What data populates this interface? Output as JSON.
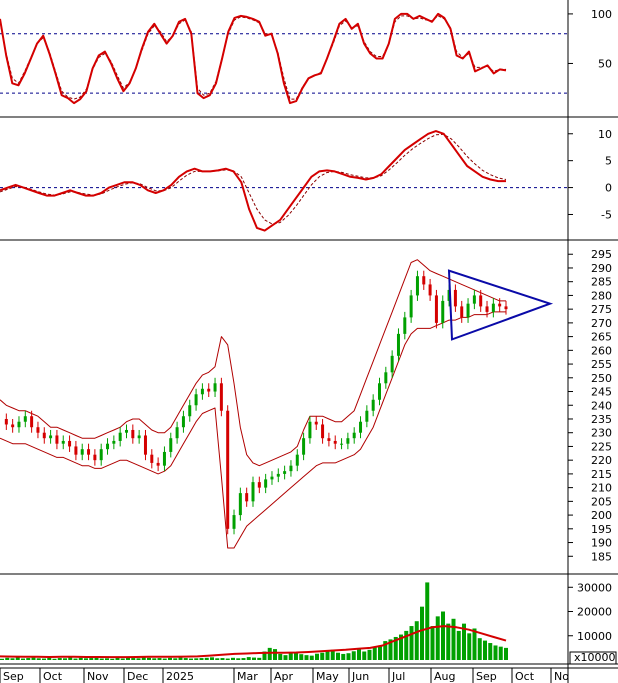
{
  "colors": {
    "price_line": "#d40000",
    "signal_line": "#8b0000",
    "bollinger": "#b00000",
    "triangle": "#0a0aa8",
    "reference": "#00008b",
    "volume_bar": "#00a000",
    "up_candle": "#00a000",
    "down_candle": "#d40000"
  },
  "chart_data": [
    {
      "type": "line",
      "panel": "stochastic",
      "y_ticks": [
        50,
        100
      ],
      "ylim": [
        0,
        110
      ],
      "reference_lines": [
        20,
        80
      ],
      "series": [
        {
          "role": "main",
          "values": [
            95,
            58,
            30,
            28,
            40,
            55,
            70,
            78,
            60,
            40,
            18,
            15,
            10,
            14,
            22,
            45,
            58,
            62,
            50,
            35,
            22,
            30,
            45,
            65,
            82,
            90,
            80,
            70,
            78,
            92,
            95,
            80,
            20,
            15,
            18,
            30,
            55,
            82,
            96,
            98,
            97,
            95,
            92,
            78,
            80,
            60,
            30,
            10,
            12,
            25,
            35,
            38,
            40,
            55,
            72,
            90,
            95,
            85,
            90,
            70,
            60,
            55,
            55,
            70,
            95,
            100,
            100,
            95,
            98,
            95,
            92,
            100,
            96,
            85,
            58,
            55,
            62,
            42,
            45,
            48,
            40,
            44,
            43
          ]
        },
        {
          "role": "signal",
          "values": [
            92,
            60,
            35,
            30,
            42,
            56,
            70,
            76,
            62,
            42,
            22,
            16,
            14,
            16,
            24,
            44,
            56,
            60,
            52,
            38,
            25,
            31,
            45,
            63,
            80,
            88,
            82,
            72,
            78,
            90,
            94,
            82,
            25,
            18,
            20,
            32,
            56,
            80,
            94,
            97,
            96,
            94,
            91,
            80,
            79,
            62,
            35,
            14,
            14,
            26,
            35,
            38,
            41,
            55,
            70,
            88,
            93,
            86,
            88,
            72,
            62,
            57,
            57,
            70,
            92,
            98,
            98,
            95,
            96,
            94,
            93,
            98,
            95,
            86,
            62,
            56,
            60,
            46,
            46,
            47,
            42,
            44,
            44
          ]
        }
      ]
    },
    {
      "type": "line",
      "panel": "macd",
      "y_ticks": [
        -5,
        0,
        5,
        10
      ],
      "ylim": [
        -9,
        12
      ],
      "reference_lines": [
        0
      ],
      "series": [
        {
          "role": "main",
          "values": [
            -0.5,
            0,
            0.5,
            0,
            -0.5,
            -1,
            -1.5,
            -1.5,
            -1,
            -0.5,
            -1,
            -1.5,
            -1.5,
            -1,
            0,
            0.5,
            1,
            1,
            0.5,
            -0.5,
            -1,
            -0.5,
            0.5,
            2,
            3,
            3.5,
            3,
            3,
            3.2,
            3.5,
            3,
            1,
            -4,
            -7.5,
            -8,
            -7,
            -6,
            -4,
            -2,
            0,
            2,
            3,
            3.2,
            3,
            2.5,
            2,
            1.8,
            1.5,
            1.8,
            2.5,
            4,
            5.5,
            7,
            8,
            9,
            10,
            10.5,
            10,
            8,
            6,
            4,
            3,
            2,
            1.5,
            1.2,
            1.2
          ]
        },
        {
          "role": "signal",
          "values": [
            -0.8,
            -0.3,
            0.2,
            0.1,
            -0.3,
            -0.8,
            -1.2,
            -1.4,
            -1.2,
            -0.8,
            -0.9,
            -1.2,
            -1.4,
            -1.2,
            -0.5,
            0.1,
            0.6,
            0.9,
            0.7,
            0,
            -0.6,
            -0.6,
            0,
            1.2,
            2.3,
            3,
            3,
            3,
            3.1,
            3.3,
            3.1,
            2,
            -1,
            -4,
            -6,
            -6.8,
            -6.5,
            -5.2,
            -3.5,
            -1.5,
            0.5,
            2,
            2.8,
            3,
            2.8,
            2.4,
            2.1,
            1.8,
            1.8,
            2.2,
            3.3,
            4.6,
            6,
            7.2,
            8.2,
            9.1,
            9.8,
            9.9,
            9,
            7.5,
            5.8,
            4.4,
            3.2,
            2.4,
            1.8,
            1.5
          ]
        }
      ]
    },
    {
      "type": "line",
      "panel": "price",
      "y_ticks": [
        185,
        190,
        195,
        200,
        205,
        210,
        215,
        220,
        225,
        230,
        235,
        240,
        245,
        250,
        255,
        260,
        265,
        270,
        275,
        280,
        285,
        290,
        295
      ],
      "ylim": [
        180,
        298
      ],
      "x_values": [
        0,
        5,
        10,
        15,
        20,
        25,
        30,
        35,
        40,
        45,
        50,
        55,
        60,
        65,
        70,
        75,
        80,
        85,
        90,
        95,
        100,
        105,
        110,
        115,
        120,
        125,
        130,
        135,
        140,
        145,
        150,
        155,
        160,
        165,
        170,
        175,
        180,
        185,
        190,
        195,
        200,
        205,
        210,
        215,
        220,
        225,
        230,
        235,
        240,
        245,
        250,
        255,
        260,
        265,
        270,
        275,
        280,
        285,
        290,
        295,
        300,
        305,
        310,
        315,
        320,
        325,
        330,
        335,
        340,
        345,
        350,
        355,
        360,
        365,
        370,
        375,
        380,
        385,
        390,
        395,
        400,
        405,
        410,
        415,
        420,
        425,
        430,
        435,
        440,
        445,
        450,
        455,
        460,
        465,
        470,
        475,
        480,
        485,
        490,
        495,
        500,
        505
      ],
      "series": [
        {
          "role": "close",
          "values": [
            235,
            233,
            232,
            234,
            236,
            232,
            230,
            228,
            229,
            226,
            227,
            225,
            222,
            224,
            222,
            220,
            224,
            226,
            227,
            230,
            231,
            228,
            229,
            222,
            219,
            218,
            223,
            228,
            232,
            236,
            240,
            244,
            246,
            245,
            248,
            238,
            195,
            200,
            208,
            205,
            212,
            210,
            213,
            214,
            215,
            216,
            218,
            222,
            228,
            234,
            233,
            228,
            227,
            226,
            226,
            228,
            230,
            234,
            238,
            242,
            248,
            252,
            258,
            266,
            272,
            280,
            287,
            284,
            280,
            270,
            278,
            282,
            276,
            272,
            277,
            280,
            276,
            274,
            277,
            276,
            275
          ]
        },
        {
          "role": "upper_band",
          "values": [
            242,
            240,
            239,
            238,
            238,
            237,
            236,
            234,
            232,
            232,
            231,
            230,
            229,
            228,
            228,
            228,
            229,
            230,
            231,
            232,
            234,
            235,
            235,
            233,
            231,
            230,
            230,
            232,
            236,
            240,
            244,
            248,
            251,
            252,
            254,
            265,
            262,
            248,
            232,
            222,
            219,
            218,
            219,
            220,
            221,
            222,
            223,
            225,
            231,
            236,
            236,
            236,
            235,
            234,
            234,
            236,
            238,
            244,
            250,
            256,
            262,
            268,
            274,
            280,
            286,
            292,
            293,
            291,
            289,
            288,
            287,
            286,
            285,
            284,
            283,
            282,
            281,
            280,
            279,
            278,
            278
          ]
        },
        {
          "role": "lower_band",
          "values": [
            228,
            227,
            226,
            226,
            226,
            225,
            224,
            223,
            222,
            221,
            221,
            220,
            219,
            218,
            218,
            217,
            217,
            218,
            219,
            220,
            220,
            219,
            218,
            217,
            216,
            215,
            216,
            218,
            222,
            226,
            230,
            234,
            237,
            238,
            239,
            214,
            188,
            188,
            192,
            196,
            198,
            200,
            202,
            204,
            206,
            208,
            210,
            212,
            214,
            216,
            218,
            219,
            219,
            219,
            220,
            221,
            222,
            224,
            228,
            232,
            238,
            244,
            250,
            256,
            262,
            266,
            268,
            268,
            268,
            269,
            270,
            271,
            271,
            272,
            272,
            273,
            273,
            273,
            274,
            274,
            274
          ]
        }
      ],
      "triangle": [
        [
          0,
          289
        ],
        [
          1,
          264
        ],
        [
          2,
          277
        ]
      ]
    },
    {
      "type": "bar",
      "panel": "volume",
      "y_ticks": [
        10000,
        20000,
        30000
      ],
      "ylim": [
        0,
        33000
      ],
      "unit_label": "x10000",
      "values": [
        500,
        900,
        700,
        1200,
        600,
        800,
        1000,
        700,
        600,
        900,
        500,
        800,
        700,
        1100,
        600,
        900,
        700,
        800,
        1200,
        600,
        700,
        500,
        900,
        600,
        1000,
        800,
        700,
        1300,
        900,
        700,
        800,
        600,
        900,
        700,
        1000,
        800,
        600,
        700,
        800,
        900,
        1100,
        700,
        800,
        600,
        900,
        700,
        800,
        1200,
        1000,
        900,
        3500,
        5000,
        4500,
        2500,
        2000,
        2800,
        3200,
        2400,
        2000,
        1800,
        2600,
        3000,
        3800,
        4200,
        3000,
        2500,
        2800,
        3600,
        4500,
        3500,
        4200,
        5200,
        6000,
        7800,
        8500,
        9500,
        10500,
        12000,
        14000,
        16000,
        22000,
        32000,
        14000,
        18000,
        20000,
        15000,
        17000,
        12000,
        15000,
        11000,
        13000,
        9000,
        8000,
        7000,
        6000,
        5500,
        5000
      ],
      "ma_line": [
        1500,
        1400,
        1350,
        1300,
        1250,
        1300,
        1300,
        1250,
        1250,
        1200,
        1200,
        1250,
        1300,
        1300,
        1350,
        1400,
        1500,
        1800,
        2200,
        2500,
        2700,
        2900,
        3000,
        3000,
        3100,
        3300,
        3600,
        3900,
        4200,
        4600,
        5000,
        6000,
        8000,
        10000,
        12000,
        13500,
        14000,
        13500,
        12500,
        11000,
        9500,
        8000
      ]
    }
  ],
  "x_axis": {
    "labels": [
      "Sep",
      "Oct",
      "Nov",
      "Dec",
      "2025",
      "Mar",
      "Apr",
      "May",
      "Jun",
      "Jul",
      "Aug",
      "Sep",
      "Oct",
      "No"
    ]
  }
}
